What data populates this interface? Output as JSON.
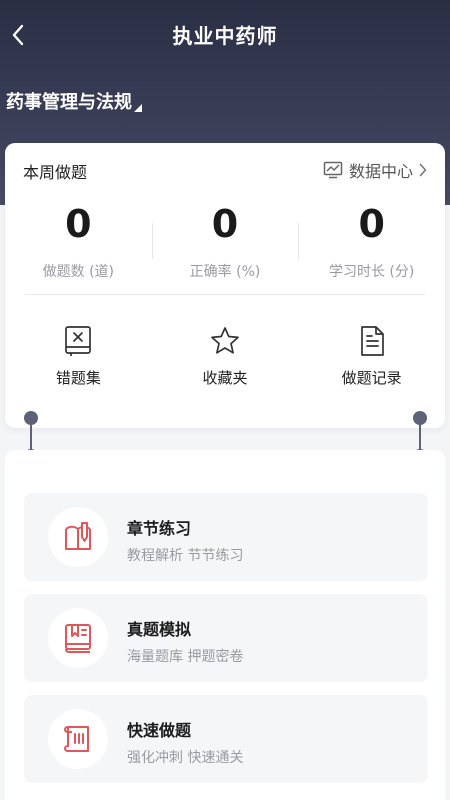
{
  "header": {
    "title": "执业中药师",
    "subject": "药事管理与法规"
  },
  "weekly": {
    "title": "本周做题",
    "data_center_label": "数据中心",
    "stats": [
      {
        "value": "0",
        "label": "做题数 (道)"
      },
      {
        "value": "0",
        "label": "正确率 (%)"
      },
      {
        "value": "0",
        "label": "学习时长 (分)"
      }
    ],
    "tools": [
      {
        "label": "错题集",
        "icon": "wrong-book-icon"
      },
      {
        "label": "收藏夹",
        "icon": "star-icon"
      },
      {
        "label": "做题记录",
        "icon": "document-icon"
      }
    ]
  },
  "modes": [
    {
      "title": "章节练习",
      "desc": "教程解析 节节练习",
      "icon": "chapter-icon"
    },
    {
      "title": "真题模拟",
      "desc": "海量题库 押题密卷",
      "icon": "book-icon"
    },
    {
      "title": "快速做题",
      "desc": "强化冲刺 快速通关",
      "icon": "scroll-icon"
    }
  ],
  "colors": {
    "header_bg": "#2b2f44",
    "accent_red": "#e0575b",
    "connector": "#5d6279"
  }
}
